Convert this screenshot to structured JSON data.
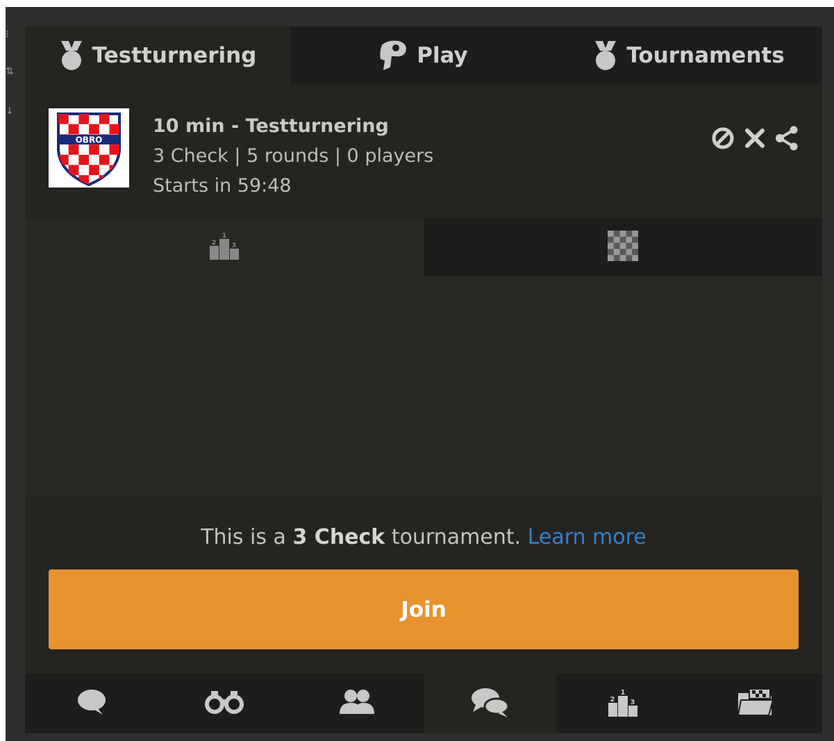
{
  "top_tabs": [
    {
      "label": "Testturnering",
      "icon": "trophy-icon",
      "active": true
    },
    {
      "label": "Play",
      "icon": "pawn-icon",
      "active": false
    },
    {
      "label": "Tournaments",
      "icon": "trophy-icon",
      "active": false
    }
  ],
  "tournament": {
    "logo_text": "OBRO",
    "title": "10 min - Testturnering",
    "details": "3 Check | 5 rounds | 0 players",
    "starts": "Starts in 59:48"
  },
  "actions": [
    "block-icon",
    "close-icon",
    "share-icon"
  ],
  "sub_tabs": [
    {
      "icon": "podium-icon",
      "active": true
    },
    {
      "icon": "chessboard-icon",
      "active": false
    }
  ],
  "variant_note": {
    "prefix": "This is a ",
    "variant": "3 Check",
    "suffix": " tournament. ",
    "link": "Learn more"
  },
  "join_label": "Join",
  "bottom_tabs": [
    {
      "icon": "chat-bubble-icon",
      "active": false
    },
    {
      "icon": "binoculars-icon",
      "active": false
    },
    {
      "icon": "users-icon",
      "active": false
    },
    {
      "icon": "chat-bubbles-icon",
      "active": true
    },
    {
      "icon": "podium-icon",
      "active": false
    },
    {
      "icon": "folder-icon",
      "active": false
    }
  ],
  "colors": {
    "accent": "#e8922f",
    "link": "#3692e7",
    "panel": "#262421"
  }
}
